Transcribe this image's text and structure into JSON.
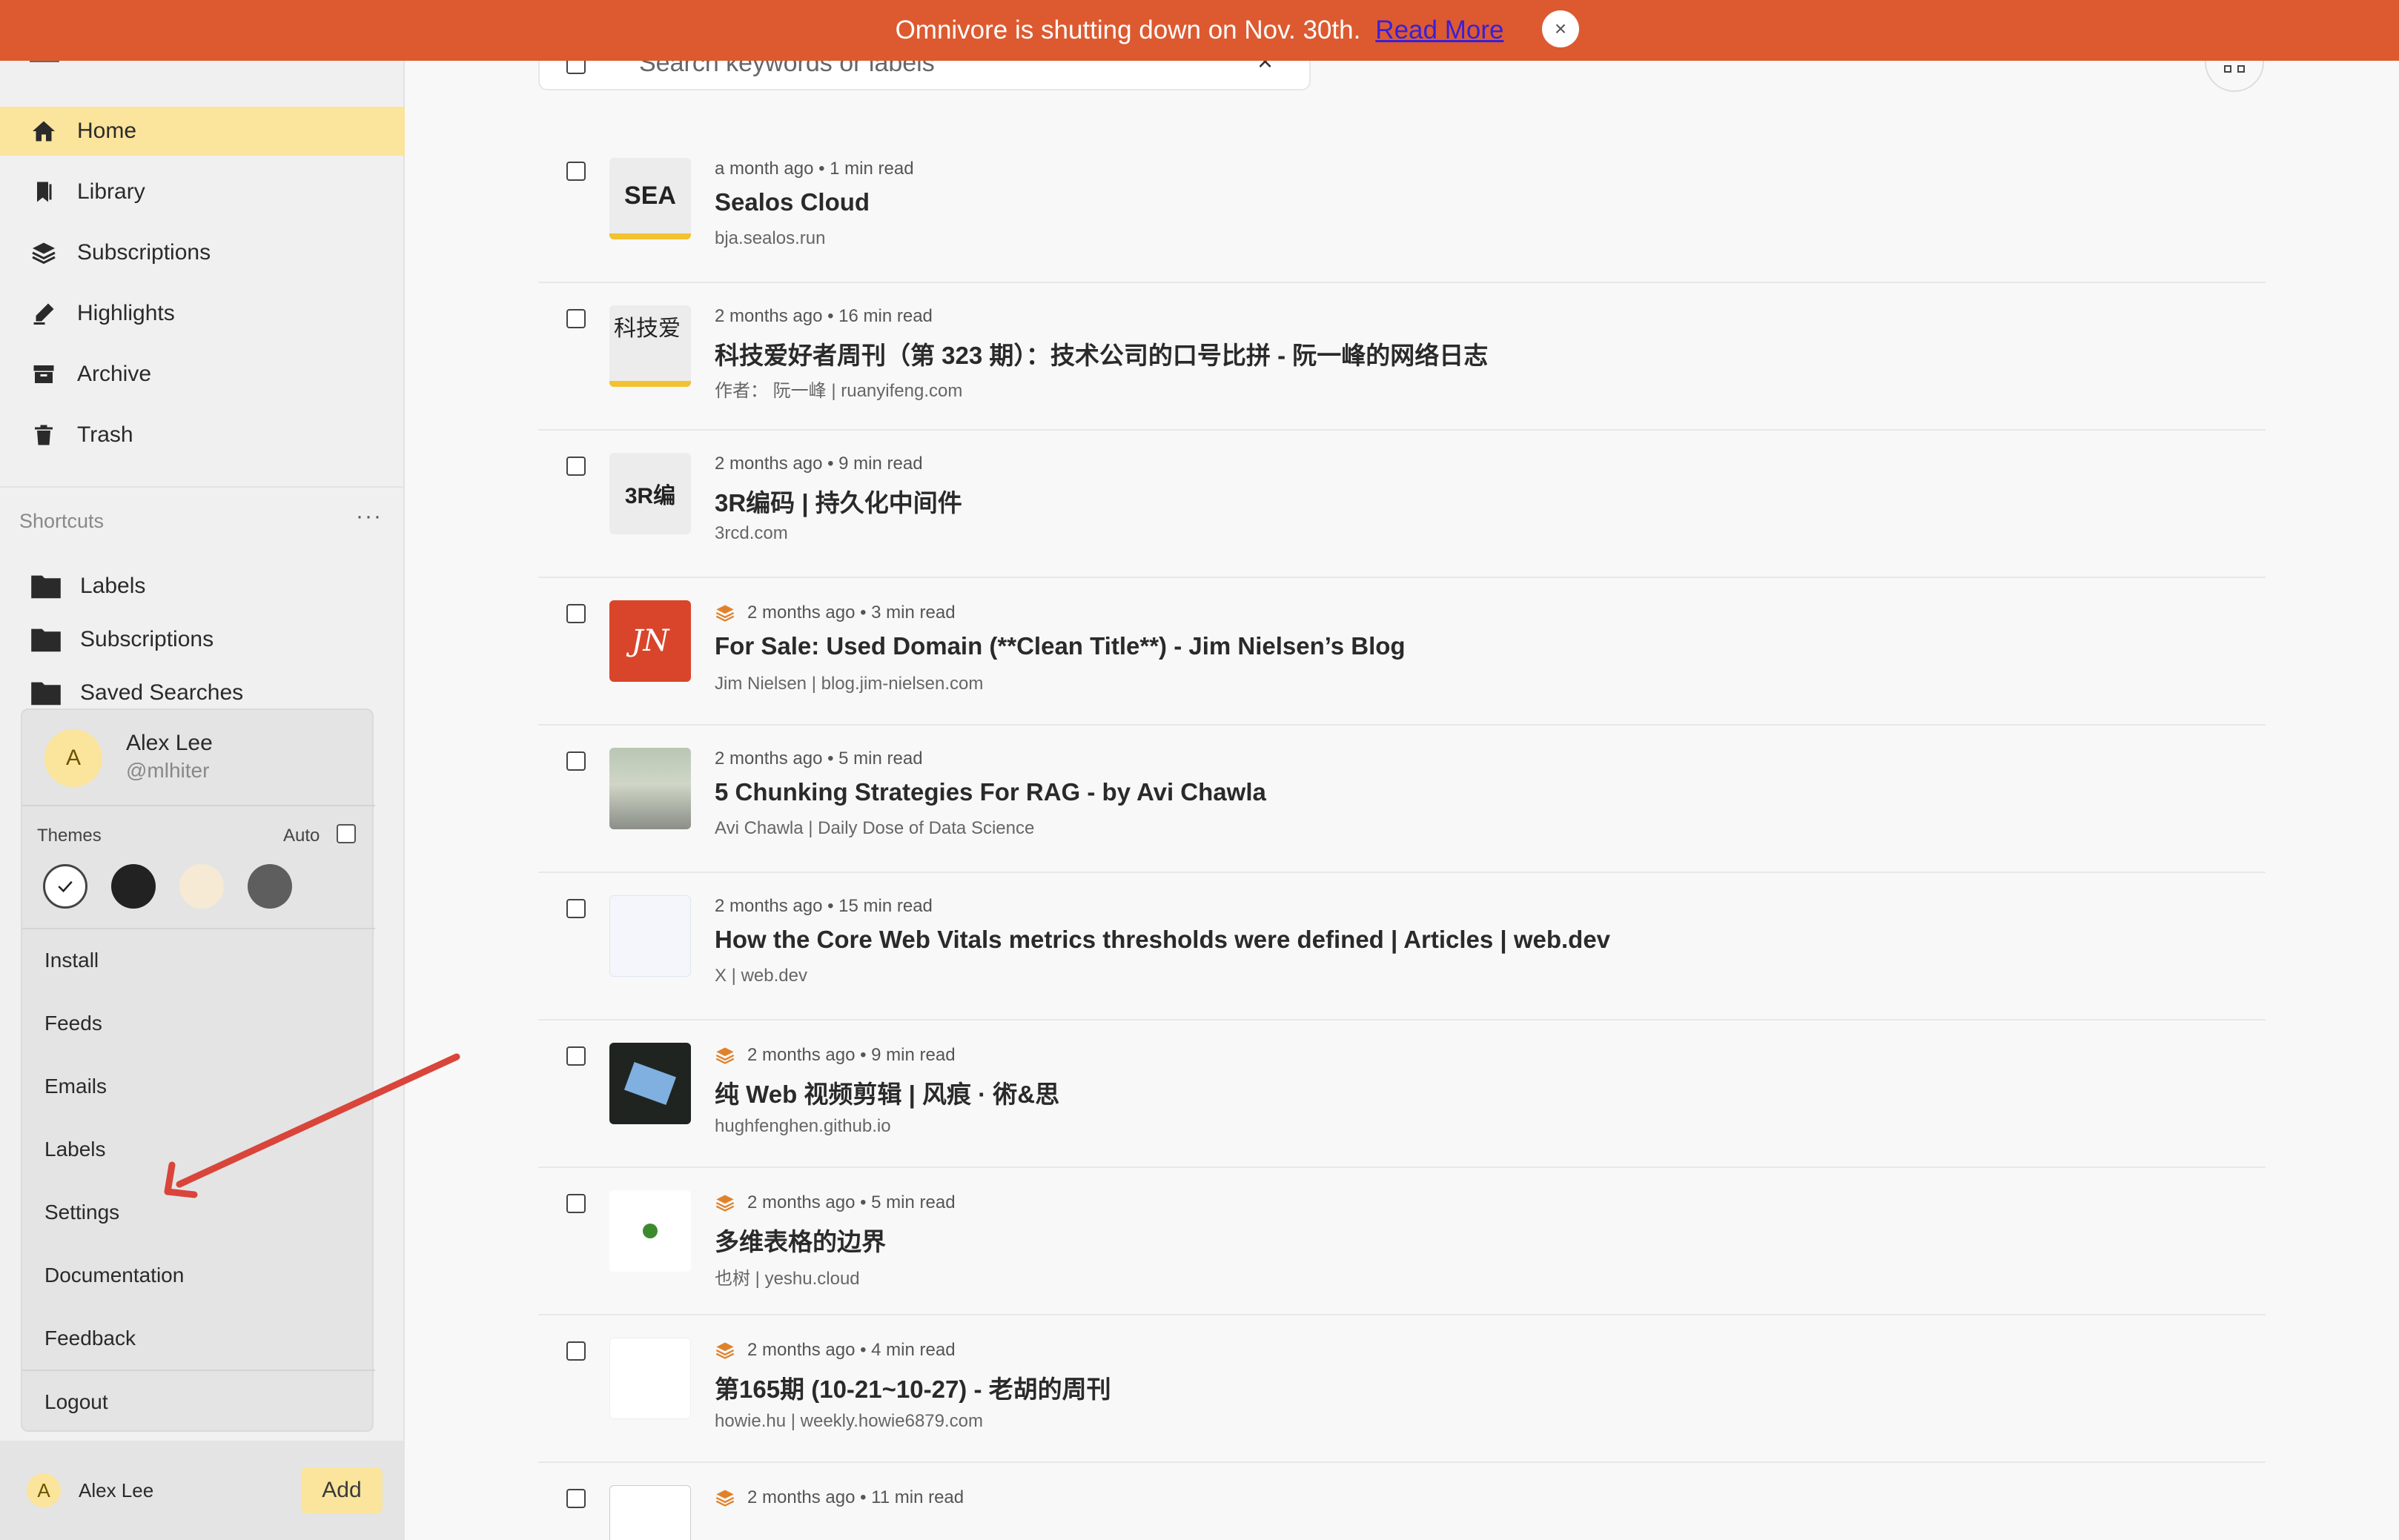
{
  "banner": {
    "message": "Omnivore is shutting down on Nov. 30th.",
    "link": "Read More",
    "close": "×"
  },
  "nav": [
    {
      "label": "Home",
      "active": true
    },
    {
      "label": "Library"
    },
    {
      "label": "Subscriptions"
    },
    {
      "label": "Highlights"
    },
    {
      "label": "Archive"
    },
    {
      "label": "Trash"
    }
  ],
  "shortcuts": {
    "title": "Shortcuts",
    "menu": "···",
    "items": [
      "Labels",
      "Subscriptions",
      "Saved Searches"
    ]
  },
  "popup": {
    "avatar_letter": "A",
    "name": "Alex Lee",
    "handle": "@mlhiter",
    "themes_label": "Themes",
    "auto_label": "Auto",
    "theme_colors": [
      "#ffffff",
      "#222222",
      "#f6ead4",
      "#5e5e5e"
    ],
    "menu": [
      "Install",
      "Feeds",
      "Emails",
      "Labels",
      "Settings",
      "Documentation",
      "Feedback",
      "Logout"
    ]
  },
  "profile_bar": {
    "avatar_letter": "A",
    "name": "Alex Lee",
    "add": "Add"
  },
  "search": {
    "placeholder": "Search keywords or labels",
    "clear": "×"
  },
  "items": [
    {
      "meta": "a month ago • 1 min read",
      "title": "Sealos Cloud",
      "source": "bja.sealos.run",
      "thumb_text": "SEA",
      "subscription": false
    },
    {
      "meta": "2 months ago • 16 min read",
      "title": "科技爱好者周刊（第 323 期）：技术公司的口号比拼 - 阮一峰的网络日志",
      "source": "作者： 阮一峰 | ruanyifeng.com",
      "thumb_text": "科技爱",
      "subscription": false
    },
    {
      "meta": "2 months ago • 9 min read",
      "title": "3R编码 | 持久化中间件",
      "source": "3rcd.com",
      "thumb_text": "3R编",
      "subscription": false
    },
    {
      "meta": "2 months ago • 3 min read",
      "title": "For Sale: Used Domain (**Clean Title**) - Jim Nielsen’s Blog",
      "source": "Jim Nielsen | blog.jim-nielsen.com",
      "thumb_text": "JN",
      "subscription": true
    },
    {
      "meta": "2 months ago • 5 min read",
      "title": "5 Chunking Strategies For RAG - by Avi Chawla",
      "source": "Avi Chawla | Daily Dose of Data Science",
      "thumb_text": "",
      "subscription": false
    },
    {
      "meta": "2 months ago • 15 min read",
      "title": "How the Core Web Vitals metrics thresholds were defined  |  Articles  |  web.dev",
      "source": "X | web.dev",
      "thumb_text": "",
      "subscription": false
    },
    {
      "meta": "2 months ago • 9 min read",
      "title": "纯 Web 视频剪辑 | 风痕 · 術&思",
      "source": "hughfenghen.github.io",
      "thumb_text": "",
      "subscription": true
    },
    {
      "meta": "2 months ago • 5 min read",
      "title": "多维表格的边界",
      "source": "也树 | yeshu.cloud",
      "thumb_text": "",
      "subscription": true
    },
    {
      "meta": "2 months ago • 4 min read",
      "title": "第165期 (10-21~10-27) - 老胡的周刊",
      "source": "howie.hu | weekly.howie6879.com",
      "thumb_text": "",
      "subscription": true
    },
    {
      "meta": "2 months ago • 11 min read",
      "title": "",
      "source": "",
      "thumb_text": "",
      "subscription": true
    }
  ]
}
